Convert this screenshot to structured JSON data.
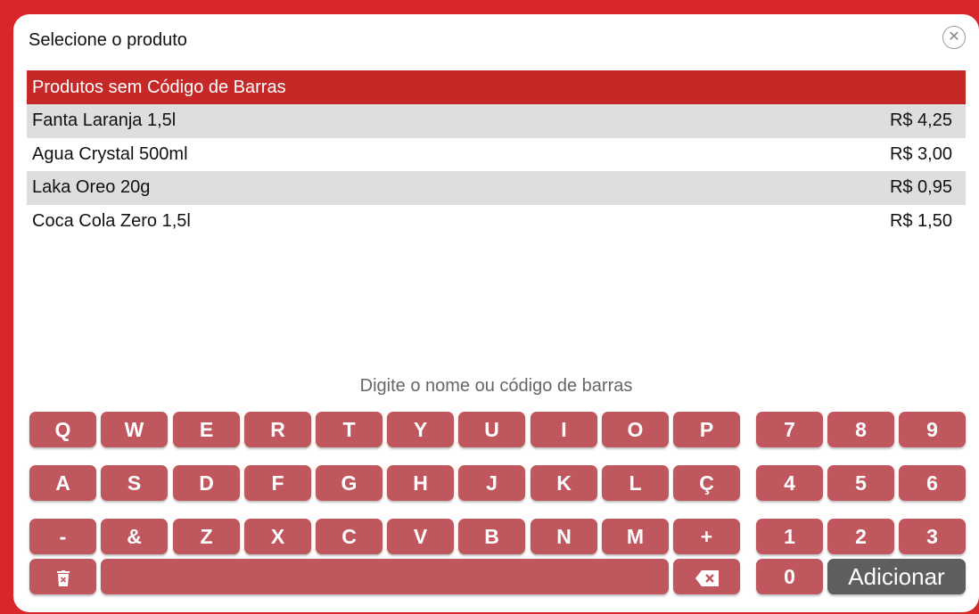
{
  "dialog": {
    "title": "Selecione o produto",
    "close_icon": "close-icon"
  },
  "list": {
    "header": "Produtos sem Código de Barras",
    "rows": [
      {
        "name": "Fanta Laranja 1,5l",
        "price": "R$ 4,25"
      },
      {
        "name": "Agua Crystal 500ml",
        "price": "R$ 3,00"
      },
      {
        "name": "Laka Oreo 20g",
        "price": "R$ 0,95"
      },
      {
        "name": "Coca Cola Zero 1,5l",
        "price": "R$ 1,50"
      }
    ]
  },
  "search": {
    "placeholder": "Digite o nome ou código de barras",
    "value": ""
  },
  "keyboard": {
    "row1": [
      "Q",
      "W",
      "E",
      "R",
      "T",
      "Y",
      "U",
      "I",
      "O",
      "P"
    ],
    "row2": [
      "A",
      "S",
      "D",
      "F",
      "G",
      "H",
      "J",
      "K",
      "L",
      "Ç"
    ],
    "row3": [
      "-",
      "&",
      "Z",
      "X",
      "C",
      "V",
      "B",
      "N",
      "M",
      "+"
    ],
    "num1": [
      "7",
      "8",
      "9"
    ],
    "num2": [
      "4",
      "5",
      "6"
    ],
    "num3": [
      "1",
      "2",
      "3"
    ],
    "zero": "0",
    "add": "Adicionar",
    "clear_icon": "trash-icon",
    "backspace_icon": "backspace-icon"
  },
  "colors": {
    "accent": "#c62828",
    "key": "#c0575e",
    "add_button": "#5e5e5e"
  }
}
